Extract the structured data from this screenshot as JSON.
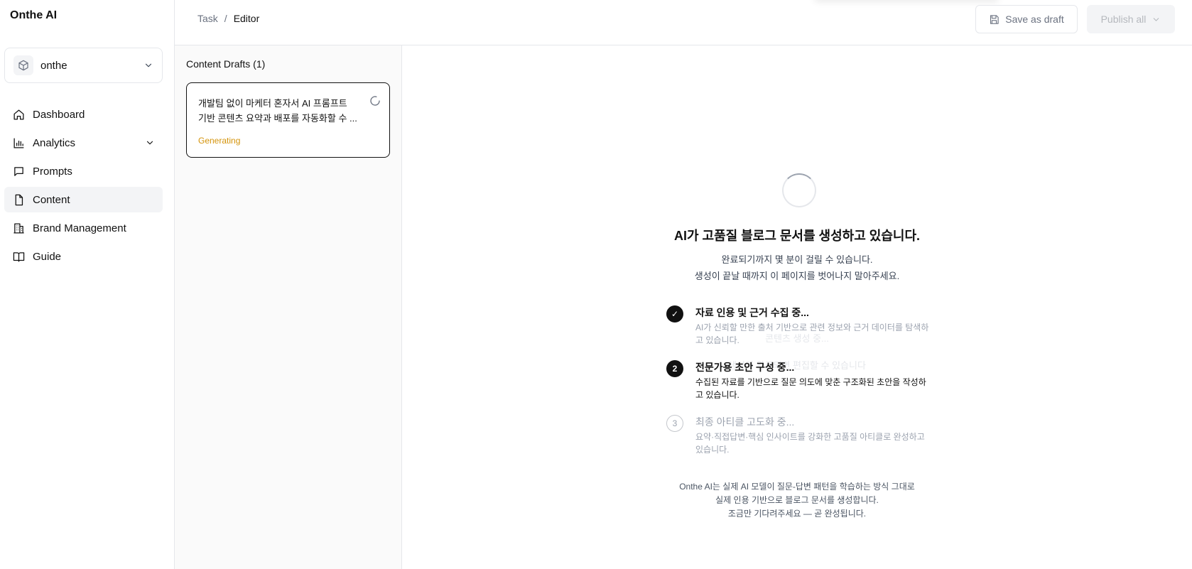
{
  "brand": "Onthe AI",
  "workspace": {
    "name": "onthe",
    "icon": "cube-icon"
  },
  "sidebar": {
    "items": [
      {
        "label": "Dashboard",
        "icon": "home-icon"
      },
      {
        "label": "Analytics",
        "icon": "bar-chart-icon",
        "expandable": true
      },
      {
        "label": "Prompts",
        "icon": "message-icon"
      },
      {
        "label": "Content",
        "icon": "file-icon",
        "active": true
      },
      {
        "label": "Brand Management",
        "icon": "building-icon"
      },
      {
        "label": "Guide",
        "icon": "book-icon"
      }
    ]
  },
  "header": {
    "breadcrumb": {
      "task": "Task",
      "sep": "/",
      "current": "Editor"
    },
    "save_draft": "Save as draft",
    "publish_all": "Publish all"
  },
  "drafts": {
    "title": "Content Drafts (1)",
    "items": [
      {
        "line1": "개발팀 없이 마케터 혼자서 AI 프롬프트",
        "line2": "기반 콘텐츠 요약과 배포를 자동화할 수 ...",
        "status": "Generating",
        "status_color": "#d4930a"
      }
    ]
  },
  "main": {
    "title": "AI가 고품질 블로그 문서를 생성하고 있습니다.",
    "subtitle_1": "완료되기까지 몇 분이 걸릴 수 있습니다.",
    "subtitle_2": "생성이 끝날 때까지 이 페이지를 벗어나지 말아주세요.",
    "ghost_1": "콘텐츠 생성 중...",
    "ghost_2": "생성이 완료되면 편집할 수 있습니다",
    "steps": [
      {
        "number": "✓",
        "state": "done",
        "title": "자료 인용 및 근거 수집 중...",
        "desc": "AI가 신뢰할 만한 출처 기반으로 관련 정보와 근거 데이터를 탐색하고 있습니다."
      },
      {
        "number": "2",
        "state": "active",
        "title": "전문가용 초안 구성 중...",
        "desc": "수집된 자료를 기반으로 질문 의도에 맞춘 구조화된 초안을 작성하고 있습니다."
      },
      {
        "number": "3",
        "state": "pending",
        "title": "최종 아티클 고도화 중...",
        "desc": "요약·직접답변·핵심 인사이트를 강화한 고품질 아티클로 완성하고 있습니다."
      }
    ],
    "footer_1": "Onthe AI는 실제 AI 모델이 질문-답변 패턴을 학습하는 방식 그대로",
    "footer_2": "실제 인용 기반으로 블로그 문서를 생성합니다.",
    "footer_3": "조금만 기다려주세요 — 곧 완성됩니다."
  },
  "colors": {
    "accent": "#111111",
    "generating": "#d4930a",
    "border": "#e5e7eb",
    "muted": "#6b7280"
  }
}
